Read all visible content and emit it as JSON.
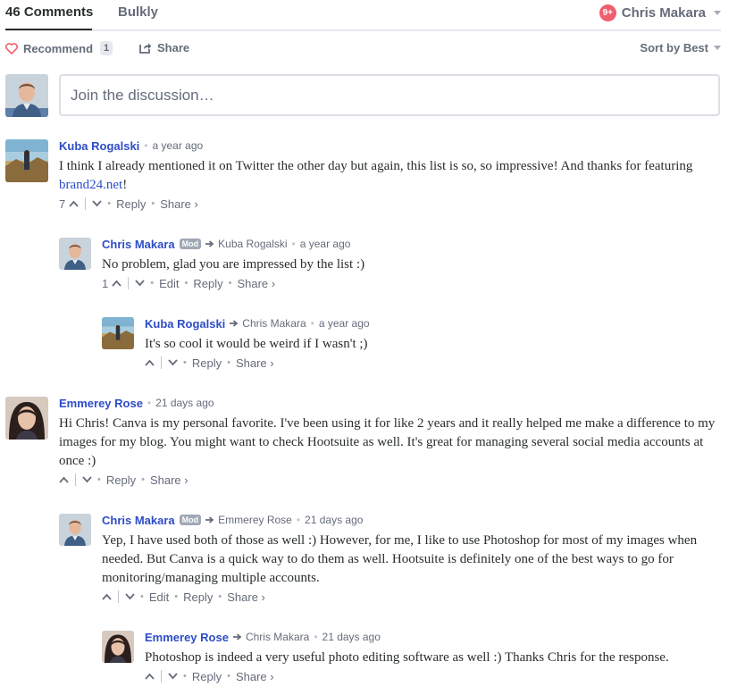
{
  "nav": {
    "comments_tab": "46 Comments",
    "community_tab": "Bulkly",
    "notif_badge": "9+",
    "user_name": "Chris Makara"
  },
  "actions": {
    "recommend_label": "Recommend",
    "recommend_count": "1",
    "share_label": "Share",
    "sort_label": "Sort by Best"
  },
  "compose": {
    "placeholder": "Join the discussion…"
  },
  "labels": {
    "reply": "Reply",
    "share": "Share ›",
    "edit": "Edit",
    "mod": "Mod"
  },
  "colors": {
    "accent": "#2e4cc7",
    "badge_red": "#f05f70",
    "muted": "#656c7a"
  },
  "comments": [
    {
      "author": "Kuba Rogalski",
      "time": "a year ago",
      "text_before": "I think I already mentioned it on Twitter the other day but again, this list is so, so impressive! And thanks for featuring ",
      "link": "brand24.net",
      "text_after": "!",
      "votes": "7"
    },
    {
      "author": "Chris Makara",
      "reply_to": "Kuba Rogalski",
      "time": "a year ago",
      "text": "No problem, glad you are impressed by the list :)",
      "votes": "1"
    },
    {
      "author": "Kuba Rogalski",
      "reply_to": "Chris Makara",
      "time": "a year ago",
      "text": "It's so cool it would be weird if I wasn't ;)",
      "votes": ""
    },
    {
      "author": "Emmerey Rose",
      "time": "21 days ago",
      "text": "Hi Chris! Canva is my personal favorite. I've been using it for like 2 years and it really helped me make a difference to my images for my blog. You might want to check Hootsuite as well. It's great for managing several social media accounts at once :)",
      "votes": ""
    },
    {
      "author": "Chris Makara",
      "reply_to": "Emmerey Rose",
      "time": "21 days ago",
      "text": "Yep, I have used both of those as well :) However, for me, I like to use Photoshop for most of my images when needed. But Canva is a quick way to do them as well. Hootsuite is definitely one of the best ways to go for monitoring/managing multiple accounts.",
      "votes": ""
    },
    {
      "author": "Emmerey Rose",
      "reply_to": "Chris Makara",
      "time": "21 days ago",
      "text": "Photoshop is indeed a very useful photo editing software as well :) Thanks Chris for the response.",
      "votes": ""
    }
  ]
}
